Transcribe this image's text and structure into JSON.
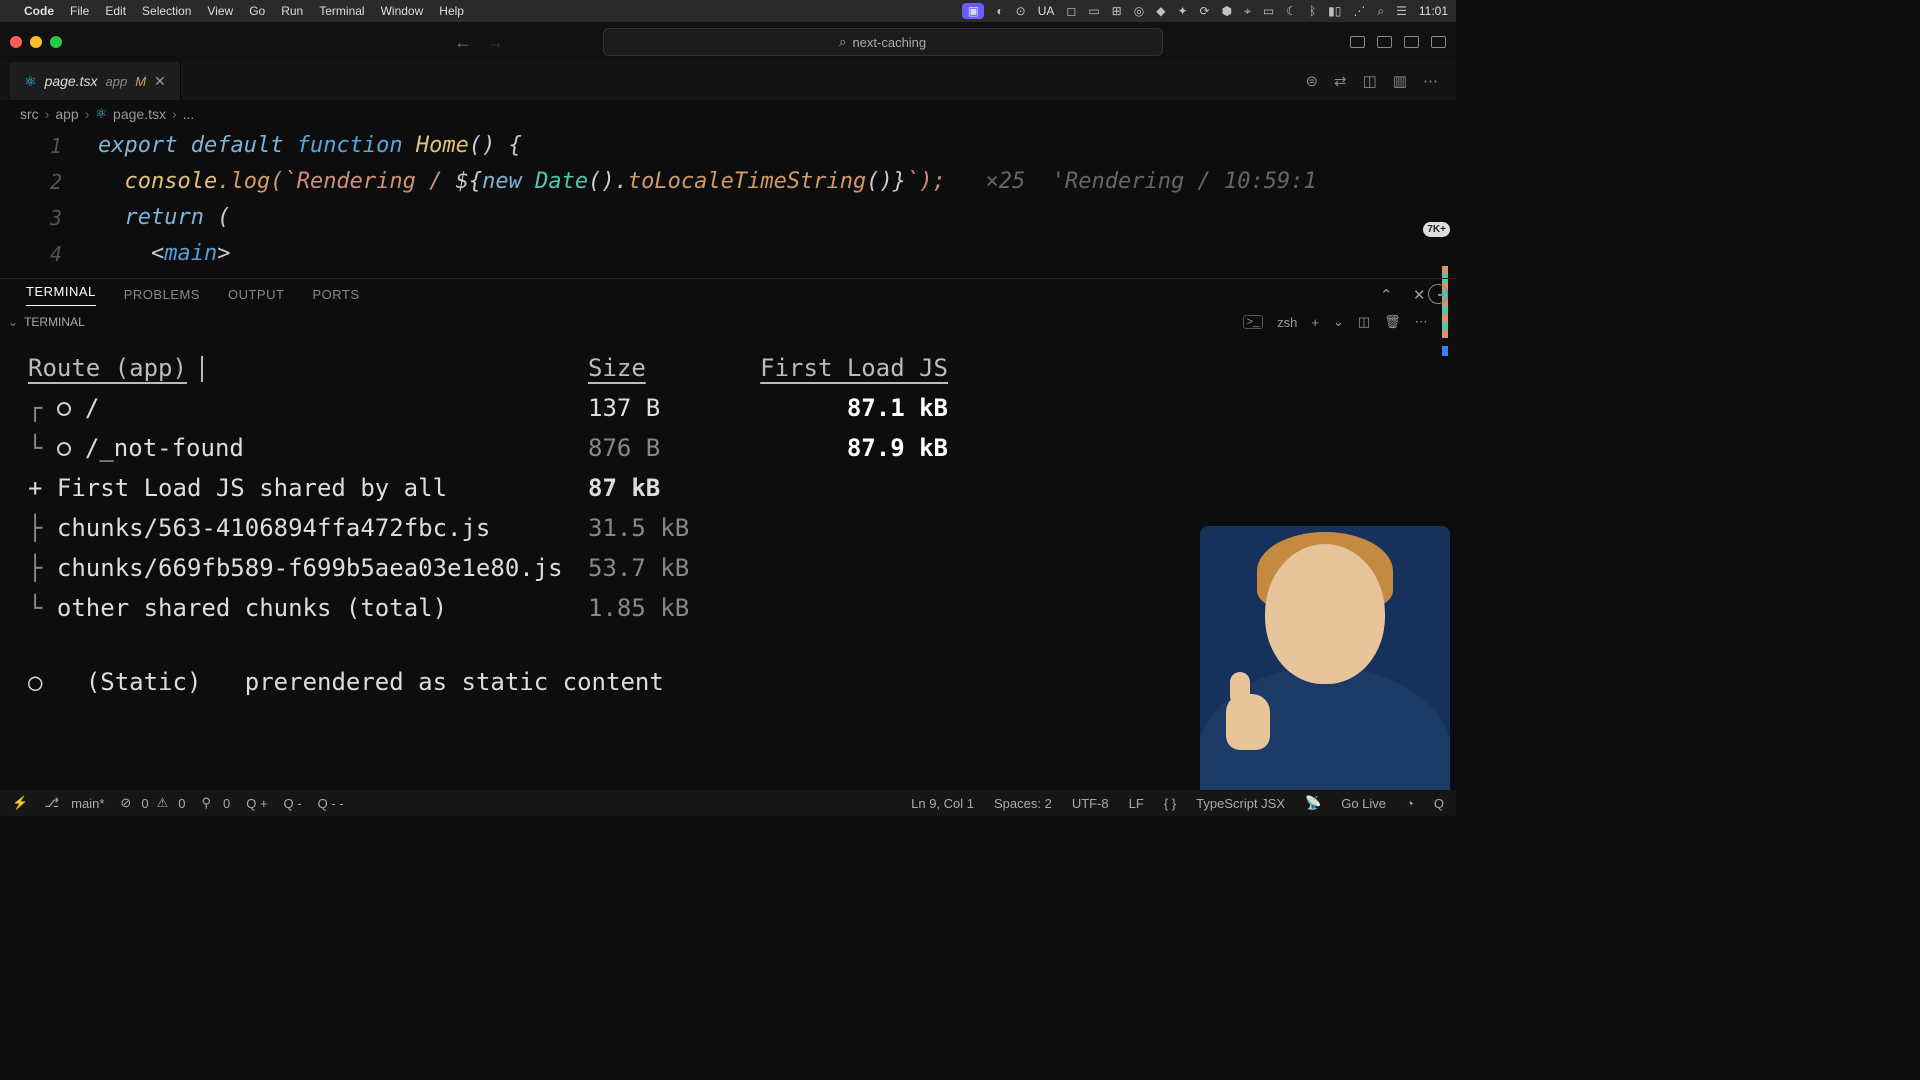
{
  "menubar": {
    "app": "Code",
    "items": [
      "File",
      "Edit",
      "Selection",
      "View",
      "Go",
      "Run",
      "Terminal",
      "Window",
      "Help"
    ],
    "right": {
      "ua": "UA",
      "time": "11:01"
    }
  },
  "titlebar": {
    "search_label": "next-caching"
  },
  "tab": {
    "filename": "page.tsx",
    "dir": "app",
    "modified": "M"
  },
  "breadcrumb": {
    "seg1": "src",
    "seg2": "app",
    "seg3": "page.tsx",
    "more": "..."
  },
  "code": {
    "l1a": "export",
    "l1b": "default",
    "l1c": "function",
    "l1d": "Home",
    "l1e": "() {",
    "l2a": "console",
    "l2b": ".log(",
    "l2c": "`Rendering / ",
    "l2d": "${",
    "l2e": "new",
    "l2f": "Date",
    "l2g": "().",
    "l2h": "toLocaleTimeString",
    "l2i": "()}",
    "l2j": "`);",
    "l2ghost_count": "×25",
    "l2ghost_text": "'Rendering / 10:59:1",
    "l3a": "return",
    "l3b": " (",
    "l4a": "<",
    "l4b": "main",
    "l4c": ">"
  },
  "panel": {
    "tabs": [
      "TERMINAL",
      "PROBLEMS",
      "OUTPUT",
      "PORTS"
    ],
    "group": "TERMINAL",
    "shell": "zsh"
  },
  "terminal": {
    "hdr_route": "Route (app)",
    "hdr_size": "Size",
    "hdr_first": "First Load JS",
    "rows": [
      {
        "tree": "┌ ",
        "marker": "o",
        "route": "/",
        "size": "137 B",
        "first": "87.1 kB",
        "bold": true
      },
      {
        "tree": "└ ",
        "marker": "o",
        "route": "/_not-found",
        "size": "876 B",
        "first": "87.9 kB",
        "bold": true
      }
    ],
    "shared_label": "+ First Load JS shared by all",
    "shared_size": "87 kB",
    "chunks": [
      {
        "tree": "  ├ ",
        "name": "chunks/563-4106894ffa472fbc.js",
        "size": "31.5 kB"
      },
      {
        "tree": "  ├ ",
        "name": "chunks/669fb589-f699b5aea03e1e80.js",
        "size": "53.7 kB"
      },
      {
        "tree": "  └ ",
        "name": "other shared chunks (total)",
        "size": "1.85 kB"
      }
    ],
    "legend_marker": "○",
    "legend_label": "(Static)",
    "legend_desc": "prerendered as static content"
  },
  "status": {
    "branch": "main*",
    "errors": "0",
    "warnings": "0",
    "port": "0",
    "q1": "Q +",
    "q2": "Q -",
    "q3": "Q - -",
    "cursor": "Ln 9, Col 1",
    "spaces": "Spaces: 2",
    "enc": "UTF-8",
    "eol": "LF",
    "lang": "TypeScript JSX",
    "golive": "Go Live",
    "q": "Q"
  },
  "badge": "7K+"
}
